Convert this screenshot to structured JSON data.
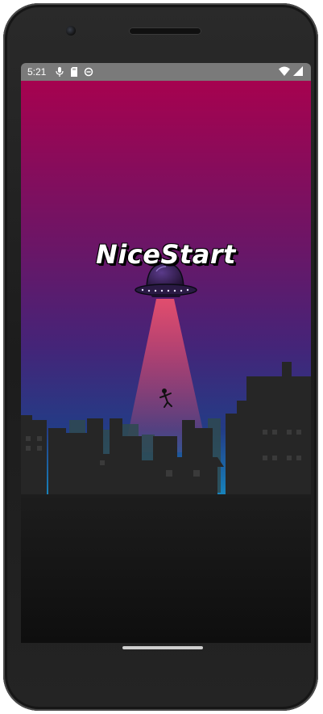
{
  "status_bar": {
    "time": "5:21",
    "left_icons": [
      "mic-icon",
      "sd-card-icon",
      "sync-icon"
    ],
    "right_icons": [
      "wifi-icon",
      "cellular-signal-icon"
    ]
  },
  "app": {
    "title": "NiceStart"
  },
  "colors": {
    "sky_top": "#a6024f",
    "sky_mid": "#452478",
    "sky_horizon": "#17b0d8",
    "city_silhouette": "#262626",
    "ground": "#141414",
    "beam": "#e8506e"
  }
}
